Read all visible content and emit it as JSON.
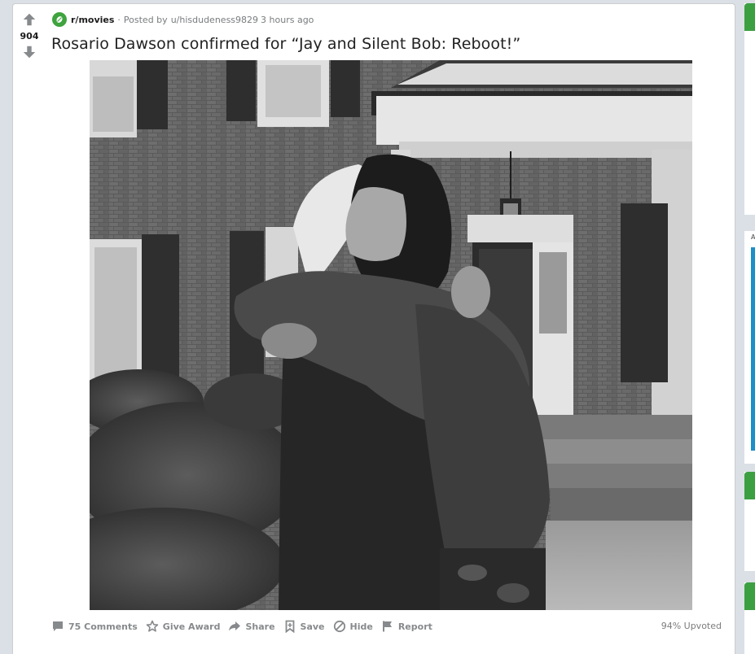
{
  "post": {
    "votes": "904",
    "subreddit": "r/movies",
    "separator": "·",
    "posted_by_label": "Posted by",
    "username": "u/hisdudeness9829",
    "time": "3 hours ago",
    "title": "Rosario Dawson confirmed for “Jay and Silent Bob: Reboot!”",
    "image_alt": "Black and white photo of two people hugging in front of a brick house"
  },
  "actions": {
    "comments": "75 Comments",
    "give_award": "Give Award",
    "share": "Share",
    "save": "Save",
    "hide": "Hide",
    "report": "Report"
  },
  "upvote_ratio": "94% Upvoted",
  "sidebar": {
    "label": "A"
  },
  "colors": {
    "subreddit_green": "#3fa33e",
    "sidebar_green": "#3ca043",
    "page_bg": "#dae0e6",
    "action_gray": "#878a8c"
  }
}
